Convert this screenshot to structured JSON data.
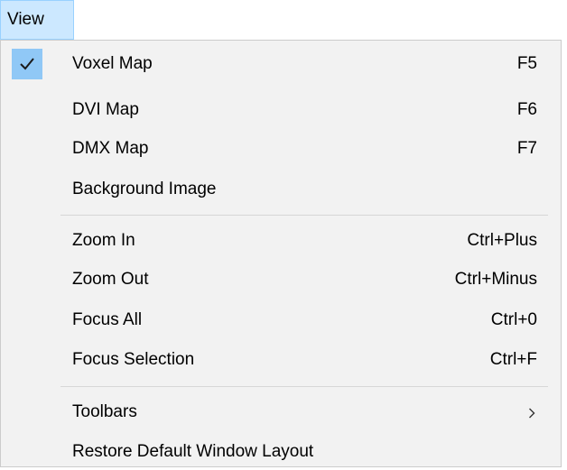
{
  "menubar": {
    "view_label": "View"
  },
  "menu": {
    "voxel_map": {
      "label": "Voxel Map",
      "shortcut": "F5",
      "checked": true
    },
    "dvi_map": {
      "label": "DVI Map",
      "shortcut": "F6"
    },
    "dmx_map": {
      "label": "DMX Map",
      "shortcut": "F7"
    },
    "background_image": {
      "label": "Background Image"
    },
    "zoom_in": {
      "label": "Zoom In",
      "shortcut": "Ctrl+Plus"
    },
    "zoom_out": {
      "label": "Zoom Out",
      "shortcut": "Ctrl+Minus"
    },
    "focus_all": {
      "label": "Focus All",
      "shortcut": "Ctrl+0"
    },
    "focus_selection": {
      "label": "Focus Selection",
      "shortcut": "Ctrl+F"
    },
    "toolbars": {
      "label": "Toolbars",
      "has_submenu": true,
      "arrow_icon": "chevron-right-icon"
    },
    "restore_layout": {
      "label": "Restore Default Window Layout"
    }
  },
  "colors": {
    "menubar_highlight": "#cce8ff",
    "check_highlight": "#90c8f6",
    "menu_background": "#f2f2f2",
    "separator": "#d7d7d7"
  }
}
